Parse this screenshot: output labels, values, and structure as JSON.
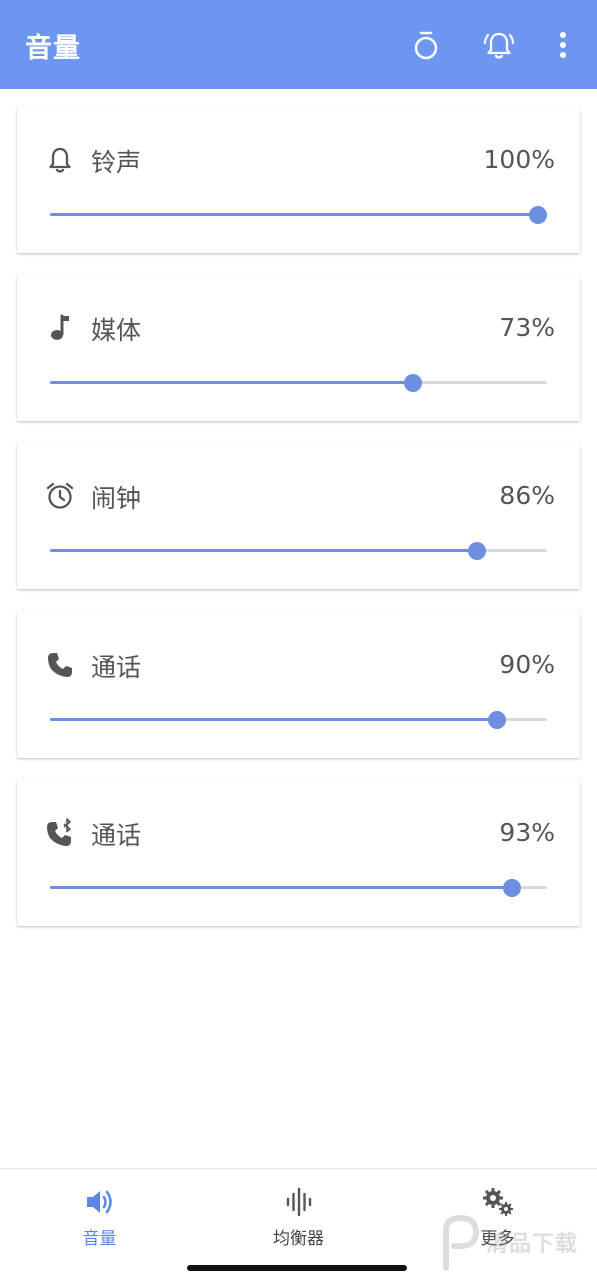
{
  "appbar": {
    "title": "音量",
    "bg_color": "#6c96ef",
    "actions": [
      {
        "icon": "timer-icon"
      },
      {
        "icon": "alarm-bell-icon"
      },
      {
        "icon": "more-vert-icon"
      }
    ]
  },
  "accent_color": "#6c8fe0",
  "volumes": [
    {
      "icon": "bell-icon",
      "label": "铃声",
      "value": "100%",
      "level": 1.0
    },
    {
      "icon": "music-note-icon",
      "label": "媒体",
      "value": "73%",
      "level": 0.73
    },
    {
      "icon": "alarm-clock-icon",
      "label": "闹钟",
      "value": "86%",
      "level": 0.86
    },
    {
      "icon": "phone-icon",
      "label": "通话",
      "value": "90%",
      "level": 0.9
    },
    {
      "icon": "bluetooth-phone-icon",
      "label": "通话",
      "value": "93%",
      "level": 0.93
    }
  ],
  "bottom_nav": [
    {
      "icon": "volume-icon",
      "label": "音量",
      "active": true
    },
    {
      "icon": "equalizer-icon",
      "label": "均衡器",
      "active": false
    },
    {
      "icon": "settings-gears-icon",
      "label": "更多",
      "active": false
    }
  ],
  "watermark": {
    "text": "清品下载"
  }
}
